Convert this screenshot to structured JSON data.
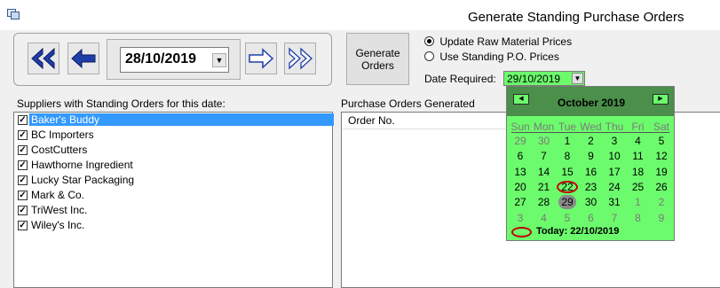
{
  "window": {
    "title": "Generate Standing Purchase Orders"
  },
  "nav": {
    "current_date": "28/10/2019",
    "first_label": "first",
    "prev_label": "previous",
    "next_label": "next",
    "last_label": "last"
  },
  "generate_button": {
    "line1": "Generate",
    "line2": "Orders"
  },
  "options": {
    "update_raw": "Update Raw Material Prices",
    "use_standing": "Use Standing P.O. Prices",
    "selected": "update_raw"
  },
  "date_required": {
    "label": "Date Required:",
    "value": "29/10/2019"
  },
  "suppliers": {
    "heading": "Suppliers with Standing Orders for this date:",
    "items": [
      {
        "name": "Baker's Buddy",
        "checked": true,
        "selected": true
      },
      {
        "name": "BC Importers",
        "checked": true
      },
      {
        "name": "CostCutters",
        "checked": true
      },
      {
        "name": "Hawthorne Ingredient",
        "checked": true
      },
      {
        "name": "Lucky Star Packaging",
        "checked": true
      },
      {
        "name": "Mark & Co.",
        "checked": true
      },
      {
        "name": "TriWest Inc.",
        "checked": true
      },
      {
        "name": "Wiley's Inc.",
        "checked": true
      }
    ]
  },
  "purchase_orders": {
    "heading": "Purchase Orders Generated",
    "column": "Order No."
  },
  "calendar": {
    "month": "October 2019",
    "days_of_week": [
      "Sun",
      "Mon",
      "Tue",
      "Wed",
      "Thu",
      "Fri",
      "Sat"
    ],
    "weeks": [
      [
        "29",
        "30",
        "1",
        "2",
        "3",
        "4",
        "5"
      ],
      [
        "6",
        "7",
        "8",
        "9",
        "10",
        "11",
        "12"
      ],
      [
        "13",
        "14",
        "15",
        "16",
        "17",
        "18",
        "19"
      ],
      [
        "20",
        "21",
        "22",
        "23",
        "24",
        "25",
        "26"
      ],
      [
        "27",
        "28",
        "29",
        "30",
        "31",
        "1",
        "2"
      ],
      [
        "3",
        "4",
        "5",
        "6",
        "7",
        "8",
        "9"
      ]
    ],
    "today_text": "Today: 22/10/2019",
    "colors": {
      "background": "#6cfb6c",
      "header": "#4a8f4a",
      "today_ring": "#c00000",
      "selected": "#8a8a8a"
    }
  }
}
